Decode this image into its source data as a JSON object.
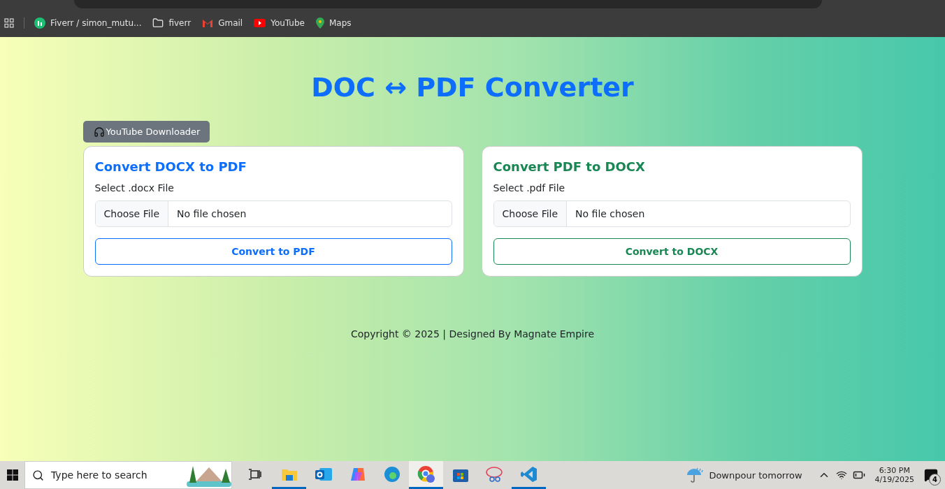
{
  "bookmarks": [
    {
      "kind": "site",
      "label": "Fiverr / simon_mutu..."
    },
    {
      "kind": "folder",
      "label": "fiverr"
    },
    {
      "kind": "mail",
      "label": "Gmail"
    },
    {
      "kind": "video",
      "label": "YouTube"
    },
    {
      "kind": "map",
      "label": "Maps"
    }
  ],
  "page": {
    "title": "DOC ↔ PDF Converter",
    "nav_button": "YouTube Downloader",
    "cards": [
      {
        "kind": "primary",
        "title": "Convert DOCX to PDF",
        "label": "Select .docx File",
        "file_button": "Choose File",
        "file_status": "No file chosen",
        "action": "Convert to PDF"
      },
      {
        "kind": "success",
        "title": "Convert PDF to DOCX",
        "label": "Select .pdf File",
        "file_button": "Choose File",
        "file_status": "No file chosen",
        "action": "Convert to DOCX"
      }
    ],
    "footer": "Copyright © 2025 | Designed By Magnate Empire"
  },
  "taskbar": {
    "search_placeholder": "Type here to search",
    "apps": [
      {
        "kind": "taskview",
        "running": false,
        "selected": false
      },
      {
        "kind": "folder",
        "running": true,
        "selected": false
      },
      {
        "kind": "mail",
        "running": false,
        "selected": false
      },
      {
        "kind": "assistant",
        "running": false,
        "selected": false
      },
      {
        "kind": "browser",
        "running": false,
        "selected": false
      },
      {
        "kind": "chrome",
        "running": true,
        "selected": true
      },
      {
        "kind": "store",
        "running": false,
        "selected": false
      },
      {
        "kind": "snip",
        "running": false,
        "selected": false
      },
      {
        "kind": "code",
        "running": true,
        "selected": false
      }
    ],
    "weather": "Downpour tomorrow",
    "time": "6:30 PM",
    "date": "4/19/2025",
    "notifications": "4"
  }
}
